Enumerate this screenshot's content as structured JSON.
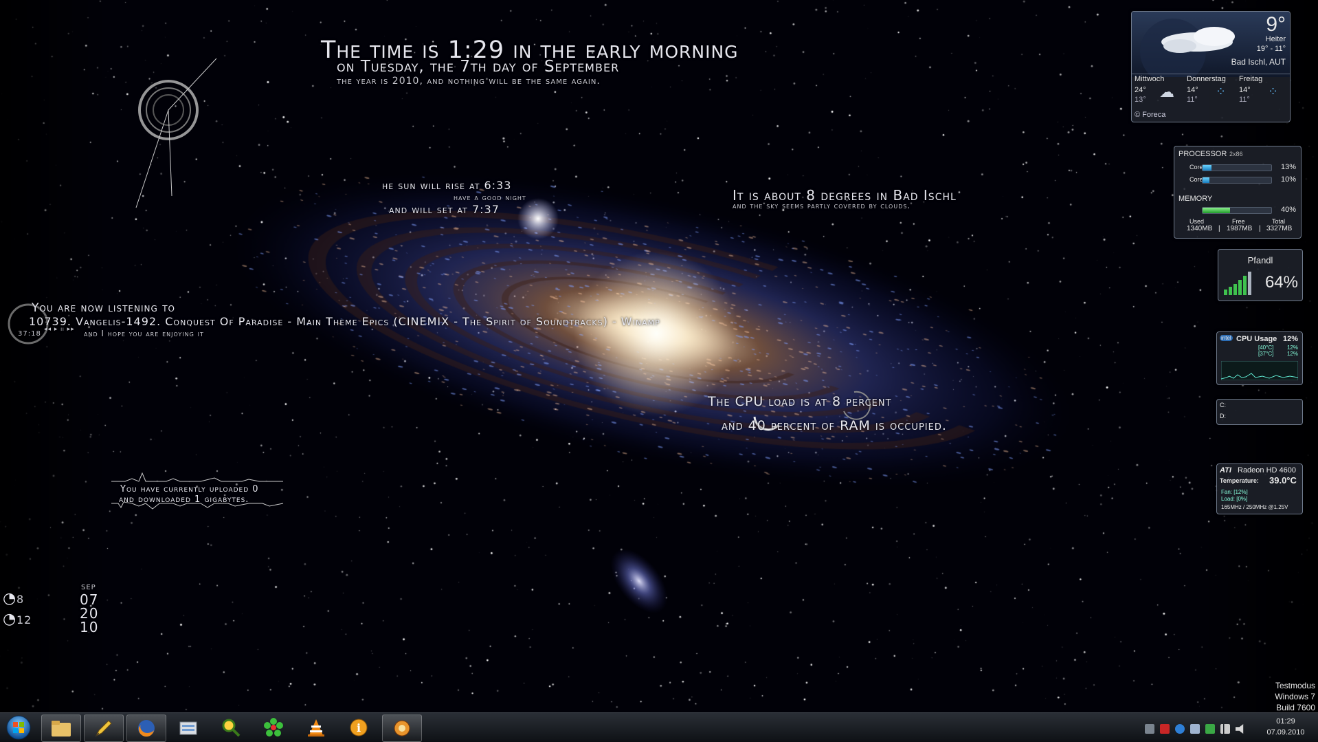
{
  "clock_text": {
    "line1": "The time is 1:29 in the early morning",
    "line2": "on Tuesday, the 7th day of September",
    "line3": "the year is 2010, and nothing will be the same again."
  },
  "sun_text": {
    "line1": "he sun will rise at 6:33",
    "line2": "have a good night",
    "line3": "and will set at 7:37"
  },
  "weather_text": {
    "line1": "It is about 8 degrees in Bad Ischl",
    "line2": "and the sky seems partly covered by clouds."
  },
  "music_text": {
    "line1": "You are now listening to",
    "line2": "10739. Vangelis-1492. Conquest Of Paradise - Main Theme Epics (CINEMIX - The Spirit of Soundtracks) - Winamp",
    "line3": "and I hope you are enjoying it",
    "time": "37:18",
    "controls": "◂◂ ▸ ıı ▸▸"
  },
  "cpu_text": {
    "line1": "The CPU load is at 8 percent",
    "line2": "and 40 percent of RAM is occupied."
  },
  "net_text": {
    "line1": "You have currently uploaded 0",
    "line2": "and downloaded 1 gigabytes."
  },
  "left_meters": {
    "cpu1": "8",
    "cpu2": "12",
    "month": "SEP",
    "day": "07",
    "year1": "20",
    "year2": "10"
  },
  "weather_gadget": {
    "temp": "9°",
    "condition": "Heiter",
    "range": "19° - 11°",
    "location": "Bad Ischl, AUT",
    "days": [
      {
        "name": "Mittwoch",
        "hi": "24°",
        "lo": "13°"
      },
      {
        "name": "Donnerstag",
        "hi": "14°",
        "lo": "11°"
      },
      {
        "name": "Freitag",
        "hi": "14°",
        "lo": "11°"
      }
    ],
    "credit": "© Foreca"
  },
  "system_gadget": {
    "processor_label": "PROCESSOR",
    "processor_type": "2x86",
    "cores": [
      {
        "name": "Core1",
        "pct": "13%",
        "value": 13
      },
      {
        "name": "Core2",
        "pct": "10%",
        "value": 10
      }
    ],
    "memory_label": "MEMORY",
    "memory_pct": "40%",
    "memory_value": 40,
    "used_label": "Used",
    "free_label": "Free",
    "total_label": "Total",
    "used": "1340MB",
    "free": "1987MB",
    "total": "3327MB",
    "separator": "|"
  },
  "wifi_gadget": {
    "name": "Pfandl",
    "pct": "64%"
  },
  "cpu_gadget": {
    "brand": "intel",
    "title": "CPU Usage",
    "pct": "12%",
    "cores": [
      {
        "temp": "[40°C]",
        "pct": "12%"
      },
      {
        "temp": "[37°C]",
        "pct": "12%"
      }
    ]
  },
  "drive_gadget": {
    "drives": [
      "C:",
      "D:"
    ]
  },
  "gpu_gadget": {
    "brand": "ATI",
    "model": "Radeon HD 4600",
    "temp_label": "Temperature:",
    "temp": "39.0°C",
    "fan": "Fan: [12%]",
    "load": "Load: [0%]",
    "clocks": "165MHz / 250MHz @1.25V"
  },
  "watermark": {
    "line1": "Testmodus",
    "line2": "Windows 7",
    "line3": "Build 7600"
  },
  "taskbar": {
    "apps": [
      {
        "name": "start",
        "glyph": ""
      },
      {
        "name": "explorer",
        "glyph": "▤"
      },
      {
        "name": "notes",
        "glyph": "✎"
      },
      {
        "name": "firefox",
        "glyph": "●"
      },
      {
        "name": "files",
        "glyph": "▥"
      },
      {
        "name": "search",
        "glyph": "⚲"
      },
      {
        "name": "icq",
        "glyph": "✿"
      },
      {
        "name": "vlc",
        "glyph": "▲"
      },
      {
        "name": "info",
        "glyph": "i"
      },
      {
        "name": "tool",
        "glyph": "✺"
      }
    ],
    "clock_time": "01:29",
    "clock_date": "07.09.2010"
  },
  "colors": {
    "accent_blue": "#3aa6e8",
    "accent_green": "#33c24a",
    "taskbar": "#1a1e24",
    "text": "#e6e6ee"
  }
}
